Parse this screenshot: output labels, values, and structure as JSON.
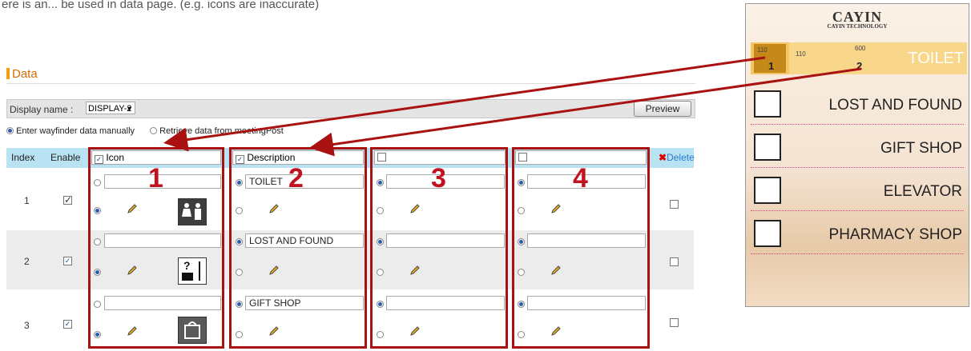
{
  "caption": "ere is an... be used in data page. (e.g. icons are inaccurate)",
  "section_title": "Data",
  "display_name": {
    "label": "Display name :",
    "value": "DISPLAY-2"
  },
  "preview_button": "Preview",
  "data_source": {
    "manual": "Enter wayfinder data manually",
    "meetingpost": "Retrieve data from meetingPost",
    "selected": "manual"
  },
  "table": {
    "headers": {
      "index": "Index",
      "enable": "Enable",
      "icon": "Icon",
      "description": "Description",
      "col3": "",
      "col4": "",
      "delete": "Delete"
    },
    "rows": [
      {
        "index": "1",
        "description": "TOILET",
        "icon": "toilet-icon"
      },
      {
        "index": "2",
        "description": "LOST AND FOUND",
        "icon": "lost-and-found-icon"
      },
      {
        "index": "3",
        "description": "GIFT SHOP",
        "icon": "gift-shop-icon"
      }
    ]
  },
  "annotations": [
    "1",
    "2",
    "3",
    "4"
  ],
  "preview_panel": {
    "logo": "CAYIN",
    "logo_sub": "CAYIN TECHNOLOGY",
    "toilet": {
      "label": "TOILET",
      "num1": "1",
      "num2": "2",
      "tick_a": "110",
      "tick_b": "110",
      "tick_c": "600"
    },
    "items": [
      "LOST AND FOUND",
      "GIFT SHOP",
      "ELEVATOR",
      "PHARMACY SHOP"
    ]
  },
  "colors": {
    "accent": "#e06a00",
    "header": "#b9e2f3",
    "red_annotation": "#a11111",
    "highlight": "#f5c564"
  }
}
